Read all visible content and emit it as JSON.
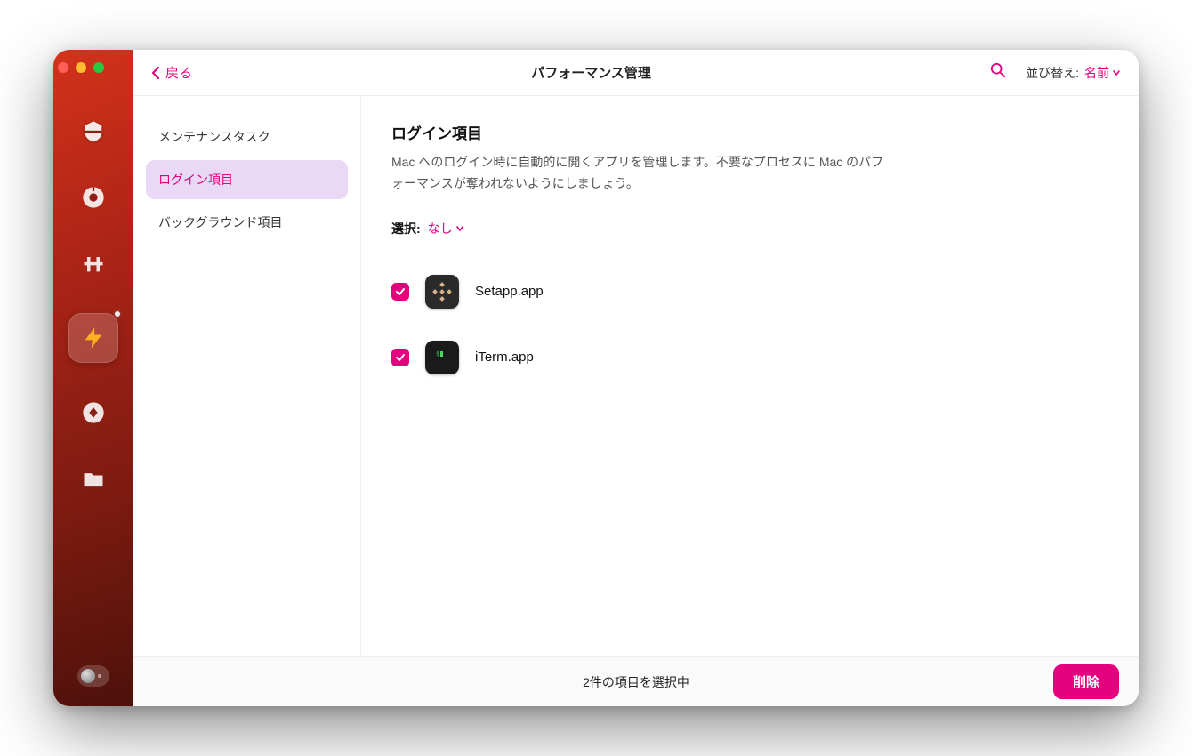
{
  "colors": {
    "accent": "#E5007D",
    "sidebar_active_bg": "#E9D9F6"
  },
  "topbar": {
    "back": "戻る",
    "title": "パフォーマンス管理",
    "sort_label": "並び替え:",
    "sort_value": "名前"
  },
  "sidebar": {
    "items": [
      {
        "label": "メンテナンスタスク",
        "active": false
      },
      {
        "label": "ログイン項目",
        "active": true
      },
      {
        "label": "バックグラウンド項目",
        "active": false
      }
    ]
  },
  "content": {
    "heading": "ログイン項目",
    "description": "Mac へのログイン時に自動的に開くアプリを管理します。不要なプロセスに Mac のパフォーマンスが奪われないようにしましょう。",
    "select_label": "選択:",
    "select_value": "なし",
    "items": [
      {
        "name": "Setapp.app",
        "checked": true,
        "icon": "setapp"
      },
      {
        "name": "iTerm.app",
        "checked": true,
        "icon": "iterm"
      }
    ]
  },
  "bottombar": {
    "status": "2件の項目を選択中",
    "delete": "削除"
  },
  "rail": {
    "icons": [
      "scan",
      "cleanup",
      "privacy",
      "performance",
      "apps",
      "files"
    ]
  }
}
